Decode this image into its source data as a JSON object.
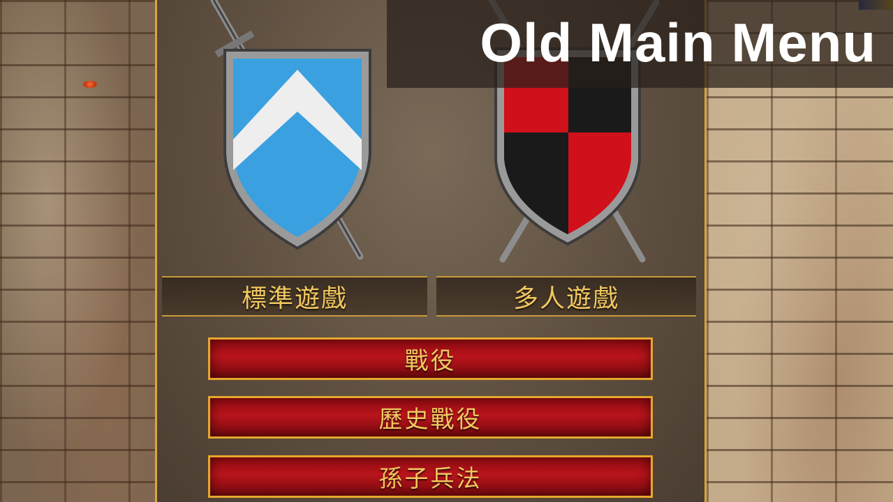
{
  "title_overlay": "Old Main Menu",
  "modes": {
    "standard": {
      "label": "標準遊戲",
      "shield_colors": {
        "primary": "#3aa0e0",
        "secondary": "#eeeeee"
      }
    },
    "multiplayer": {
      "label": "多人遊戲",
      "shield_colors": {
        "primary": "#d0101a",
        "secondary": "#1a1a1a"
      }
    }
  },
  "menu": {
    "items": [
      {
        "label": "戰役"
      },
      {
        "label": "歷史戰役"
      },
      {
        "label": "孫子兵法"
      }
    ]
  },
  "colors": {
    "accent_gold": "#e6a82c",
    "button_red": "#b8141c",
    "label_text": "#f0c860"
  }
}
